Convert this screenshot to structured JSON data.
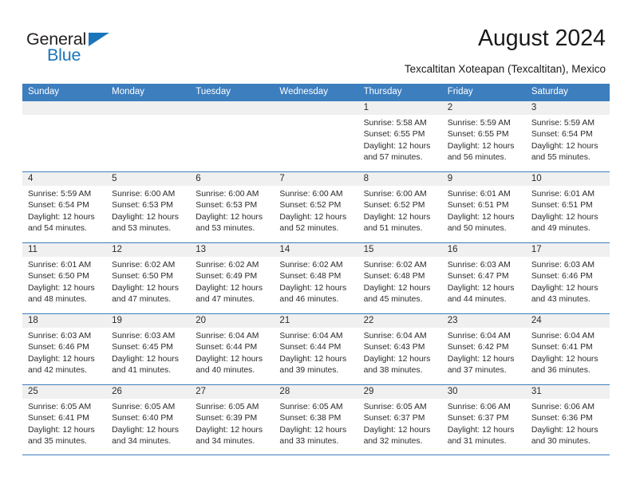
{
  "brand": {
    "name_top": "General",
    "name_bottom": "Blue",
    "accent_color": "#1b75bb",
    "triangle_icon": "triangle-icon"
  },
  "header": {
    "title": "August 2024",
    "subtitle": "Texcaltitan Xoteapan (Texcaltitan), Mexico"
  },
  "calendar": {
    "header_color": "#3d7ebf",
    "daynum_band_color": "#f0f0f0",
    "weekdays": [
      "Sunday",
      "Monday",
      "Tuesday",
      "Wednesday",
      "Thursday",
      "Friday",
      "Saturday"
    ],
    "weeks": [
      [
        {
          "date": "",
          "lines": []
        },
        {
          "date": "",
          "lines": []
        },
        {
          "date": "",
          "lines": []
        },
        {
          "date": "",
          "lines": []
        },
        {
          "date": "1",
          "lines": [
            "Sunrise: 5:58 AM",
            "Sunset: 6:55 PM",
            "Daylight: 12 hours and 57 minutes."
          ]
        },
        {
          "date": "2",
          "lines": [
            "Sunrise: 5:59 AM",
            "Sunset: 6:55 PM",
            "Daylight: 12 hours and 56 minutes."
          ]
        },
        {
          "date": "3",
          "lines": [
            "Sunrise: 5:59 AM",
            "Sunset: 6:54 PM",
            "Daylight: 12 hours and 55 minutes."
          ]
        }
      ],
      [
        {
          "date": "4",
          "lines": [
            "Sunrise: 5:59 AM",
            "Sunset: 6:54 PM",
            "Daylight: 12 hours and 54 minutes."
          ]
        },
        {
          "date": "5",
          "lines": [
            "Sunrise: 6:00 AM",
            "Sunset: 6:53 PM",
            "Daylight: 12 hours and 53 minutes."
          ]
        },
        {
          "date": "6",
          "lines": [
            "Sunrise: 6:00 AM",
            "Sunset: 6:53 PM",
            "Daylight: 12 hours and 53 minutes."
          ]
        },
        {
          "date": "7",
          "lines": [
            "Sunrise: 6:00 AM",
            "Sunset: 6:52 PM",
            "Daylight: 12 hours and 52 minutes."
          ]
        },
        {
          "date": "8",
          "lines": [
            "Sunrise: 6:00 AM",
            "Sunset: 6:52 PM",
            "Daylight: 12 hours and 51 minutes."
          ]
        },
        {
          "date": "9",
          "lines": [
            "Sunrise: 6:01 AM",
            "Sunset: 6:51 PM",
            "Daylight: 12 hours and 50 minutes."
          ]
        },
        {
          "date": "10",
          "lines": [
            "Sunrise: 6:01 AM",
            "Sunset: 6:51 PM",
            "Daylight: 12 hours and 49 minutes."
          ]
        }
      ],
      [
        {
          "date": "11",
          "lines": [
            "Sunrise: 6:01 AM",
            "Sunset: 6:50 PM",
            "Daylight: 12 hours and 48 minutes."
          ]
        },
        {
          "date": "12",
          "lines": [
            "Sunrise: 6:02 AM",
            "Sunset: 6:50 PM",
            "Daylight: 12 hours and 47 minutes."
          ]
        },
        {
          "date": "13",
          "lines": [
            "Sunrise: 6:02 AM",
            "Sunset: 6:49 PM",
            "Daylight: 12 hours and 47 minutes."
          ]
        },
        {
          "date": "14",
          "lines": [
            "Sunrise: 6:02 AM",
            "Sunset: 6:48 PM",
            "Daylight: 12 hours and 46 minutes."
          ]
        },
        {
          "date": "15",
          "lines": [
            "Sunrise: 6:02 AM",
            "Sunset: 6:48 PM",
            "Daylight: 12 hours and 45 minutes."
          ]
        },
        {
          "date": "16",
          "lines": [
            "Sunrise: 6:03 AM",
            "Sunset: 6:47 PM",
            "Daylight: 12 hours and 44 minutes."
          ]
        },
        {
          "date": "17",
          "lines": [
            "Sunrise: 6:03 AM",
            "Sunset: 6:46 PM",
            "Daylight: 12 hours and 43 minutes."
          ]
        }
      ],
      [
        {
          "date": "18",
          "lines": [
            "Sunrise: 6:03 AM",
            "Sunset: 6:46 PM",
            "Daylight: 12 hours and 42 minutes."
          ]
        },
        {
          "date": "19",
          "lines": [
            "Sunrise: 6:03 AM",
            "Sunset: 6:45 PM",
            "Daylight: 12 hours and 41 minutes."
          ]
        },
        {
          "date": "20",
          "lines": [
            "Sunrise: 6:04 AM",
            "Sunset: 6:44 PM",
            "Daylight: 12 hours and 40 minutes."
          ]
        },
        {
          "date": "21",
          "lines": [
            "Sunrise: 6:04 AM",
            "Sunset: 6:44 PM",
            "Daylight: 12 hours and 39 minutes."
          ]
        },
        {
          "date": "22",
          "lines": [
            "Sunrise: 6:04 AM",
            "Sunset: 6:43 PM",
            "Daylight: 12 hours and 38 minutes."
          ]
        },
        {
          "date": "23",
          "lines": [
            "Sunrise: 6:04 AM",
            "Sunset: 6:42 PM",
            "Daylight: 12 hours and 37 minutes."
          ]
        },
        {
          "date": "24",
          "lines": [
            "Sunrise: 6:04 AM",
            "Sunset: 6:41 PM",
            "Daylight: 12 hours and 36 minutes."
          ]
        }
      ],
      [
        {
          "date": "25",
          "lines": [
            "Sunrise: 6:05 AM",
            "Sunset: 6:41 PM",
            "Daylight: 12 hours and 35 minutes."
          ]
        },
        {
          "date": "26",
          "lines": [
            "Sunrise: 6:05 AM",
            "Sunset: 6:40 PM",
            "Daylight: 12 hours and 34 minutes."
          ]
        },
        {
          "date": "27",
          "lines": [
            "Sunrise: 6:05 AM",
            "Sunset: 6:39 PM",
            "Daylight: 12 hours and 34 minutes."
          ]
        },
        {
          "date": "28",
          "lines": [
            "Sunrise: 6:05 AM",
            "Sunset: 6:38 PM",
            "Daylight: 12 hours and 33 minutes."
          ]
        },
        {
          "date": "29",
          "lines": [
            "Sunrise: 6:05 AM",
            "Sunset: 6:37 PM",
            "Daylight: 12 hours and 32 minutes."
          ]
        },
        {
          "date": "30",
          "lines": [
            "Sunrise: 6:06 AM",
            "Sunset: 6:37 PM",
            "Daylight: 12 hours and 31 minutes."
          ]
        },
        {
          "date": "31",
          "lines": [
            "Sunrise: 6:06 AM",
            "Sunset: 6:36 PM",
            "Daylight: 12 hours and 30 minutes."
          ]
        }
      ]
    ]
  }
}
